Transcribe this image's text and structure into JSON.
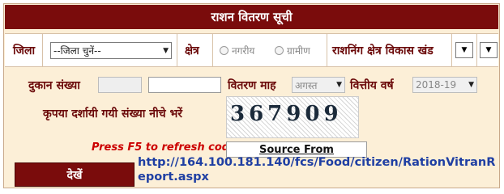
{
  "title": "राशन वितरण सूची",
  "district": {
    "label": "जिला",
    "selected": "--जिला चुनें--"
  },
  "area": {
    "label": "क्षेत्र",
    "options": [
      "नगरीय",
      "ग्रामीण"
    ]
  },
  "rationing_block": {
    "label": "राशनिंग क्षेत्र विकास खंड"
  },
  "shop": {
    "label": "दुकान संख्या",
    "value1": "",
    "value2": ""
  },
  "month": {
    "label": "वितरण माह",
    "selected": "अगस्त"
  },
  "fin_year": {
    "label": "वित्तीय वर्ष",
    "selected": "2018-19"
  },
  "captcha": {
    "label": "कृपया दर्शायी गयी संख्या नीचे भरें",
    "code": "367909"
  },
  "refresh_hint": "Press F5 to refresh code",
  "source_label": "Source From",
  "submit_label": "देखें",
  "source_url": "http://164.100.181.140/fcs/Food/citizen/RationVitranReport.aspx"
}
